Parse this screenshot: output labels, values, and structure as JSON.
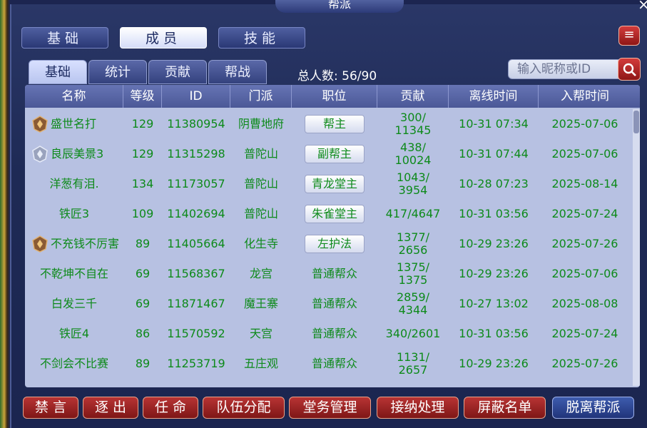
{
  "window": {
    "title": "帮派",
    "close": "×"
  },
  "top_tabs": [
    {
      "label": "基础"
    },
    {
      "label": "成员"
    },
    {
      "label": "技能"
    }
  ],
  "sub_tabs": [
    {
      "label": "基础"
    },
    {
      "label": "统计"
    },
    {
      "label": "贡献"
    },
    {
      "label": "帮战"
    }
  ],
  "total": {
    "label": "总人数:",
    "value": "56/90"
  },
  "search": {
    "placeholder": "输入昵称或ID"
  },
  "columns": [
    "名称",
    "等级",
    "ID",
    "门派",
    "职位",
    "贡献",
    "离线时间",
    "入帮时间"
  ],
  "members": [
    {
      "name": "盛世名打",
      "level": "129",
      "id": "11380954",
      "school": "阴曹地府",
      "role": "帮主",
      "contrib": "300/\n11345",
      "offline": "10-31 07:34",
      "joined": "2025-07-06"
    },
    {
      "name": "良辰美景3",
      "level": "129",
      "id": "11315298",
      "school": "普陀山",
      "role": "副帮主",
      "contrib": "438/\n10024",
      "offline": "10-31 07:44",
      "joined": "2025-07-06"
    },
    {
      "name": "洋葱有泪.",
      "level": "134",
      "id": "11173057",
      "school": "普陀山",
      "role": "青龙堂主",
      "contrib": "1043/\n3954",
      "offline": "10-28 07:23",
      "joined": "2025-08-14"
    },
    {
      "name": "铁匠3",
      "level": "109",
      "id": "11402694",
      "school": "普陀山",
      "role": "朱雀堂主",
      "contrib": "417/4647",
      "offline": "10-31 03:56",
      "joined": "2025-07-24"
    },
    {
      "name": "不充钱不厉害",
      "level": "89",
      "id": "11405664",
      "school": "化生寺",
      "role": "左护法",
      "contrib": "1377/\n2656",
      "offline": "10-29 23:26",
      "joined": "2025-07-26"
    },
    {
      "name": "不乾坤不自在",
      "level": "69",
      "id": "11568367",
      "school": "龙宫",
      "role": "普通帮众",
      "contrib": "1375/\n1375",
      "offline": "10-29 23:26",
      "joined": "2025-07-06"
    },
    {
      "name": "白发三千",
      "level": "69",
      "id": "11871467",
      "school": "魔王寨",
      "role": "普通帮众",
      "contrib": "2859/\n4344",
      "offline": "10-27 13:02",
      "joined": "2025-08-08"
    },
    {
      "name": "铁匠4",
      "level": "86",
      "id": "11570592",
      "school": "天宫",
      "role": "普通帮众",
      "contrib": "340/2601",
      "offline": "10-31 03:56",
      "joined": "2025-07-24"
    },
    {
      "name": "不剑会不比赛",
      "level": "89",
      "id": "11253719",
      "school": "五庄观",
      "role": "普通帮众",
      "contrib": "1131/\n2657",
      "offline": "10-29 23:26",
      "joined": "2025-07-26"
    }
  ],
  "role_buttons": [
    "帮主",
    "副帮主",
    "青龙堂主",
    "朱雀堂主",
    "左护法"
  ],
  "badges": {
    "0": "bronze-crest-icon",
    "1": "silver-crest-icon",
    "4": "bronze-crest-icon"
  },
  "actions": [
    {
      "label": "禁 言"
    },
    {
      "label": "逐 出"
    },
    {
      "label": "任 命"
    },
    {
      "label": "队伍分配"
    },
    {
      "label": "堂务管理"
    },
    {
      "label": "接纳处理"
    },
    {
      "label": "屏蔽名单"
    },
    {
      "label": "脱离帮派"
    }
  ],
  "colors": {
    "member_text": "#0d8a1a",
    "action_red": "#b83434",
    "action_blue": "#3e5cae"
  }
}
